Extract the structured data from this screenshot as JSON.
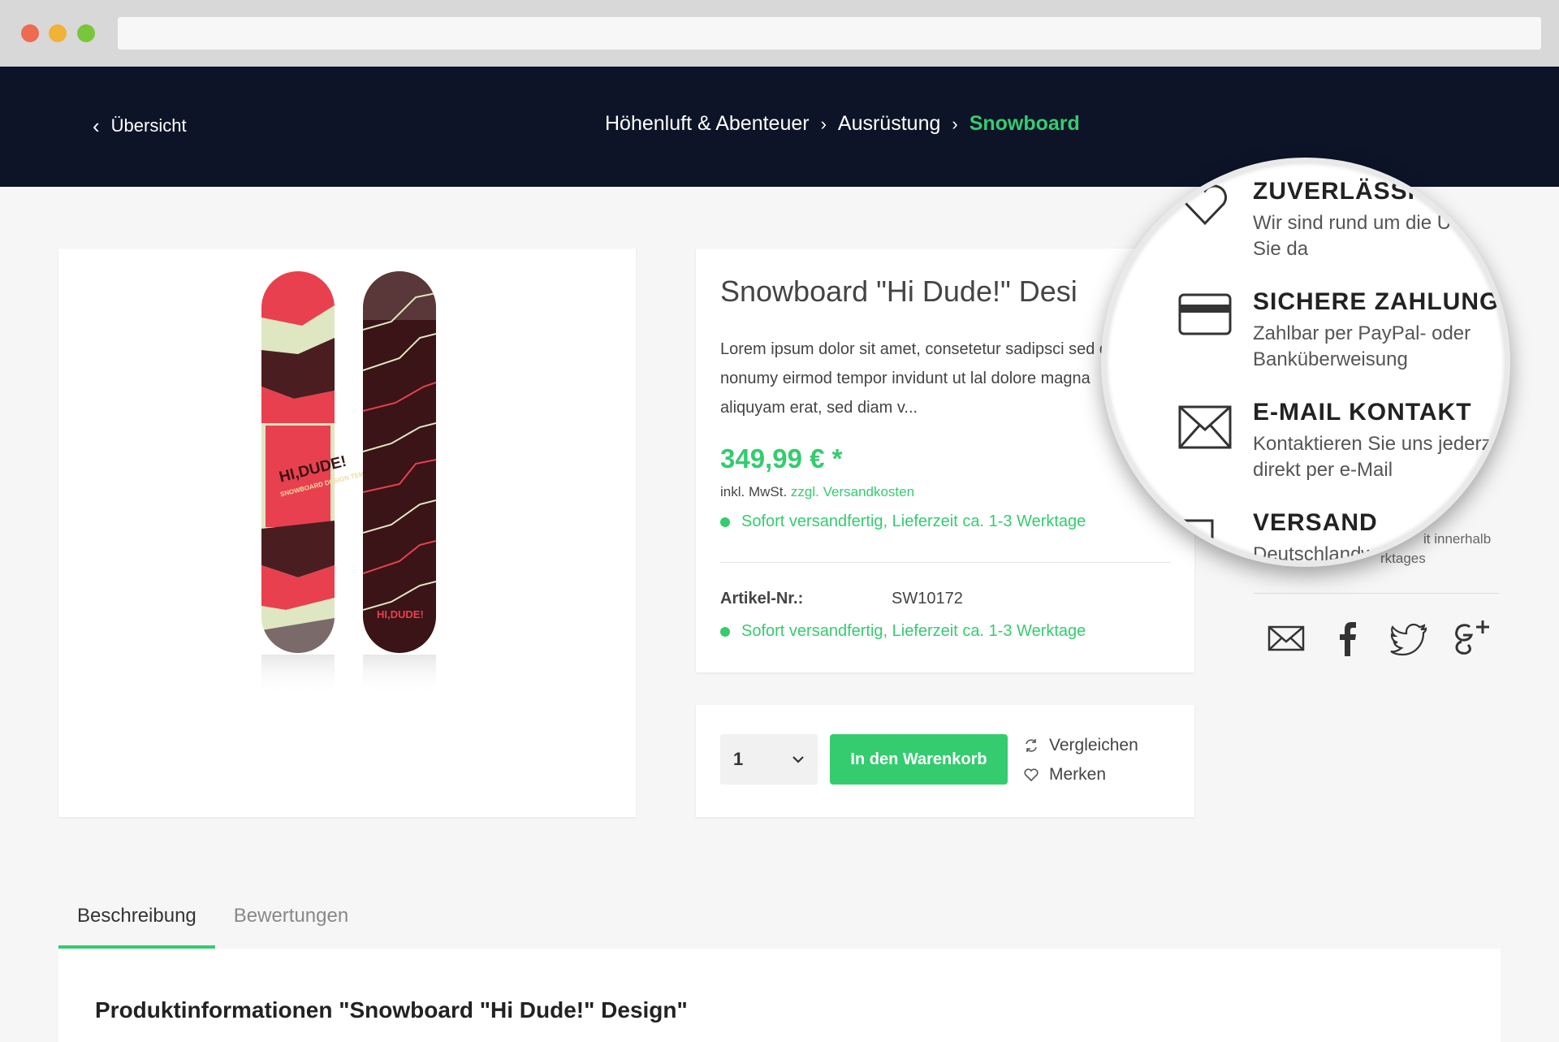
{
  "header": {
    "back_label": "Übersicht",
    "breadcrumb": [
      "Höhenluft & Abenteuer",
      "Ausrüstung",
      "Snowboard"
    ]
  },
  "product": {
    "title": "Snowboard \"Hi Dude!\" Desi",
    "description": "Lorem ipsum dolor sit amet, consetetur sadipsci sed diam nonumy eirmod tempor invidunt ut lal dolore magna aliquyam erat, sed diam v...",
    "price": "349,99 € *",
    "tax_prefix": "inkl. MwSt.",
    "shipping_link": "zzgl. Versandkosten",
    "stock": "Sofort versandfertig, Lieferzeit ca. 1-3 Werktage",
    "article_label": "Artikel-Nr.:",
    "article_number": "SW10172",
    "board_text_front": "HI,DUDE!",
    "board_sub_front": "SNOWBOARD DESIGN TEMPLATE",
    "board_text_back": "HI,DUDE!"
  },
  "buy": {
    "quantity": "1",
    "add_to_cart": "In den Warenkorb",
    "compare": "Vergleichen",
    "remember": "Merken"
  },
  "trust": {
    "items": [
      {
        "title": "ZUVERLÄSSIG",
        "text1": "Wir sind rund um die U",
        "text2": "Sie da",
        "icon": "heart-icon"
      },
      {
        "title": "SICHERE ZAHLUNG",
        "text1": "Zahlbar per PayPal- oder",
        "text2": "Banküberweisung",
        "icon": "credit-card-icon"
      },
      {
        "title": "E-MAIL KONTAKT",
        "text1": "Kontaktieren Sie uns jederz",
        "text2": "direkt per e-Mail",
        "icon": "mail-icon"
      },
      {
        "title": "VERSAND",
        "text1": "Deutschlandwe",
        "text2": "",
        "icon": "box-icon"
      }
    ],
    "behind_text1": "it innerhalb",
    "behind_text2": "rktages"
  },
  "social": [
    "mail-icon",
    "facebook-icon",
    "twitter-icon",
    "google-plus-icon"
  ],
  "tabs": [
    "Beschreibung",
    "Bewertungen"
  ],
  "content": {
    "heading": "Produktinformationen \"Snowboard \"Hi Dude!\" Design\""
  },
  "colors": {
    "accent": "#34cc6f",
    "header_bg": "#0d1428",
    "board_red": "#e8404f",
    "board_cream": "#dfe6c2",
    "board_dark": "#3a1416"
  }
}
